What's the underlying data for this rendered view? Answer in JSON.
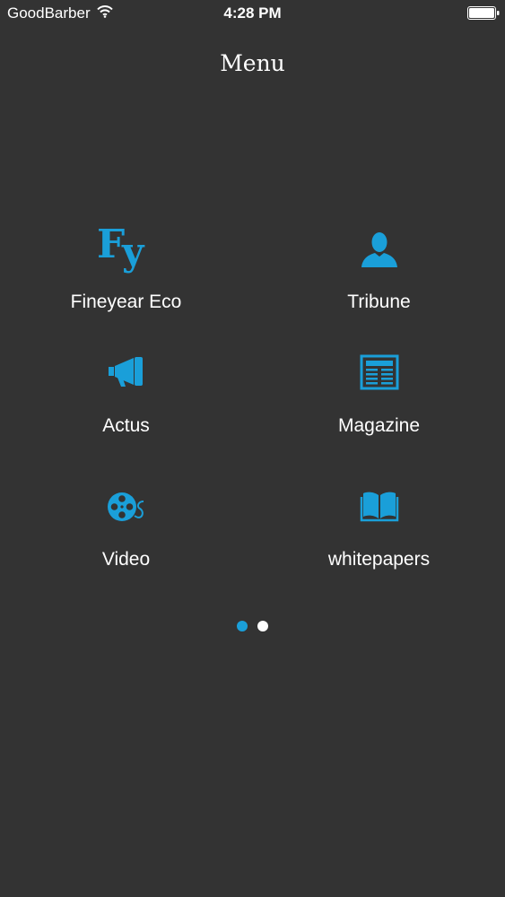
{
  "status_bar": {
    "carrier": "GoodBarber",
    "time": "4:28 PM",
    "wifi_icon": "wifi-icon",
    "battery_icon": "battery-icon"
  },
  "header": {
    "title": "Menu"
  },
  "menu": {
    "items": [
      {
        "label": "Fineyear Eco",
        "icon": "fineyear-logo-icon"
      },
      {
        "label": "Tribune",
        "icon": "person-icon"
      },
      {
        "label": "Actus",
        "icon": "megaphone-icon"
      },
      {
        "label": "Magazine",
        "icon": "newspaper-icon"
      },
      {
        "label": "Video",
        "icon": "film-reel-icon"
      },
      {
        "label": "whitepapers",
        "icon": "open-book-icon"
      }
    ]
  },
  "pager": {
    "total_pages": 2,
    "current_page": 1
  },
  "colors": {
    "background": "#333333",
    "accent": "#1a9fd9",
    "text": "#ffffff"
  }
}
